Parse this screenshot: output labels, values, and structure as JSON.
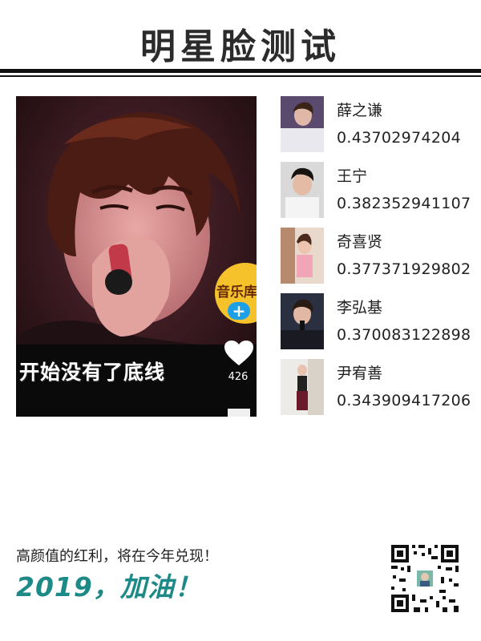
{
  "header": {
    "title": "明星脸测试"
  },
  "main_photo": {
    "caption": "开始没有了底线",
    "badge_label": "音乐库",
    "follow_symbol": "+",
    "like_count": "426"
  },
  "results": [
    {
      "name": "薛之谦",
      "score": "0.43702974204"
    },
    {
      "name": "王宁",
      "score": "0.382352941107"
    },
    {
      "name": "奇喜贤",
      "score": "0.377371929802"
    },
    {
      "name": "李弘基",
      "score": "0.370083122898"
    },
    {
      "name": "尹宥善",
      "score": "0.343909417206"
    }
  ],
  "footer": {
    "slogan": "高颜值的红利，将在今年兑现！",
    "year_slogan": "2019，加油！"
  },
  "colors": {
    "accent": "#1d8a87",
    "badge": "#f5c22c",
    "follow": "#1fa0e6"
  },
  "icons": [
    "heart-icon",
    "plus-icon",
    "qr-code-icon"
  ]
}
